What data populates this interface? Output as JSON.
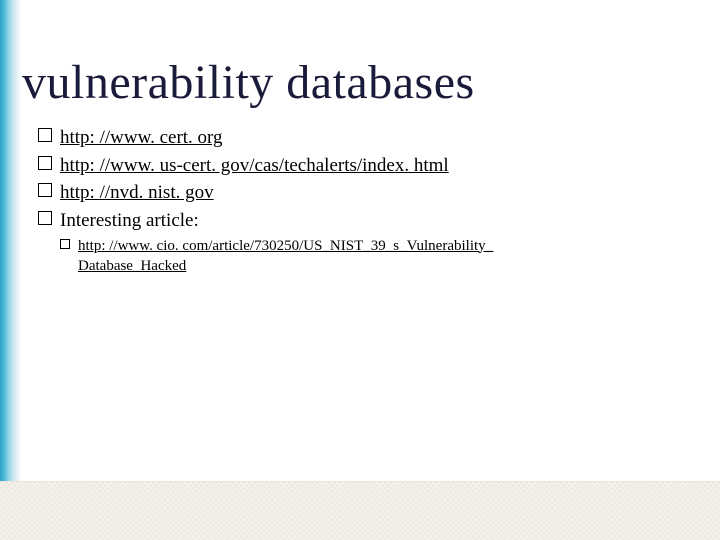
{
  "title": "vulnerability databases",
  "items": [
    {
      "text": "http: //www. cert. org",
      "link": true
    },
    {
      "text": "http: //www. us-cert. gov/cas/techalerts/index. html",
      "link": true
    },
    {
      "text": "http: //nvd. nist. gov",
      "link": true
    },
    {
      "text": "Interesting article:",
      "link": false
    }
  ],
  "subitem": {
    "line1": "http: //www. cio. com/article/730250/US_NIST_39_s_Vulnerability_",
    "line2": "Database_Hacked"
  }
}
